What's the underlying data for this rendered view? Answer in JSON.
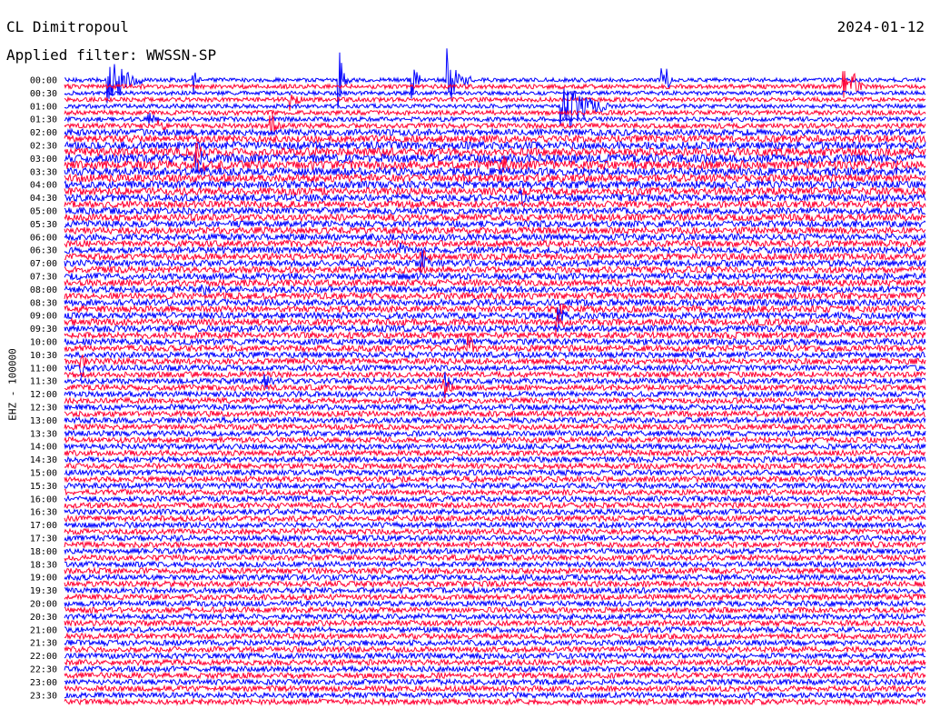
{
  "header": {
    "station": "CL Dimitropoul",
    "filter_prefix": "Applied filter: ",
    "filter_name": "WWSSN-SP",
    "date": "2024-01-12"
  },
  "chart_data": {
    "type": "helicorder",
    "title": "CL Dimitropoul",
    "subtitle": "Applied filter: WWSSN-SP",
    "date": "2024-01-12",
    "ylabel": "EHZ - 100000",
    "row_interval_minutes": 15,
    "colors": {
      "trace_a": "#0000ff",
      "trace_b": "#ff0033",
      "background": "#ffffff"
    },
    "time_labels": [
      "00:00",
      "00:30",
      "01:00",
      "01:30",
      "02:00",
      "02:30",
      "03:00",
      "03:30",
      "04:00",
      "04:30",
      "05:00",
      "05:30",
      "06:00",
      "06:30",
      "07:00",
      "07:30",
      "08:00",
      "08:30",
      "09:00",
      "09:30",
      "10:00",
      "10:30",
      "11:00",
      "11:30",
      "12:00",
      "12:30",
      "13:00",
      "13:30",
      "14:00",
      "14:30",
      "15:00",
      "15:30",
      "16:00",
      "16:30",
      "17:00",
      "17:30",
      "18:00",
      "18:30",
      "19:00",
      "19:30",
      "20:00",
      "20:30",
      "21:00",
      "21:30",
      "22:00",
      "22:30",
      "23:00",
      "23:30"
    ],
    "row_noise_levels": [
      0.15,
      0.22,
      0.15,
      0.22,
      0.2,
      0.25,
      0.25,
      0.32,
      0.55,
      0.65,
      0.75,
      0.8,
      0.9,
      0.9,
      0.8,
      0.75,
      0.7,
      0.7,
      0.65,
      0.6,
      0.6,
      0.6,
      0.55,
      0.55,
      0.55,
      0.55,
      0.55,
      0.55,
      0.55,
      0.55,
      0.55,
      0.55,
      0.55,
      0.55,
      0.55,
      0.55,
      0.55,
      0.55,
      0.55,
      0.5,
      0.5,
      0.5,
      0.45,
      0.45,
      0.4,
      0.4,
      0.4,
      0.4,
      0.4,
      0.4,
      0.4,
      0.4,
      0.4,
      0.4,
      0.4,
      0.4,
      0.4,
      0.4,
      0.4,
      0.4,
      0.4,
      0.4,
      0.4,
      0.4,
      0.4,
      0.4,
      0.4,
      0.4,
      0.4,
      0.4,
      0.4,
      0.4,
      0.4,
      0.4,
      0.4,
      0.4,
      0.4,
      0.4,
      0.4,
      0.4,
      0.4,
      0.4,
      0.4,
      0.4,
      0.4,
      0.4,
      0.4,
      0.4,
      0.4,
      0.4,
      0.4,
      0.4,
      0.4,
      0.4,
      0.4,
      0.4
    ],
    "events": [
      {
        "row": 0,
        "minute": 4.6,
        "amplitude": 12,
        "duration_min": 3.5
      },
      {
        "row": 0,
        "minute": 13.5,
        "amplitude": 4,
        "duration_min": 0.8
      },
      {
        "row": 0,
        "minute": 28.7,
        "amplitude": 10,
        "duration_min": 1.2
      },
      {
        "row": 0,
        "minute": 36.3,
        "amplitude": 6,
        "duration_min": 1.2
      },
      {
        "row": 0,
        "minute": 40,
        "amplitude": 9,
        "duration_min": 2.5
      },
      {
        "row": 0,
        "minute": 62.5,
        "amplitude": 8,
        "duration_min": 1.2
      },
      {
        "row": 1,
        "minute": 81.5,
        "amplitude": 5,
        "duration_min": 1.5
      },
      {
        "row": 1,
        "minute": 82.5,
        "amplitude": 4,
        "duration_min": 1.5
      },
      {
        "row": 3,
        "minute": 23.5,
        "amplitude": 3,
        "duration_min": 1.5
      },
      {
        "row": 4,
        "minute": 52,
        "amplitude": 10,
        "duration_min": 5
      },
      {
        "row": 6,
        "minute": 8.8,
        "amplitude": 3,
        "duration_min": 1
      },
      {
        "row": 7,
        "minute": 9.8,
        "amplitude": 2.5,
        "duration_min": 1
      },
      {
        "row": 7,
        "minute": 21.6,
        "amplitude": 4,
        "duration_min": 1
      },
      {
        "row": 11,
        "minute": 13.8,
        "amplitude": 3,
        "duration_min": 0.8
      },
      {
        "row": 12,
        "minute": 13.8,
        "amplitude": 3.5,
        "duration_min": 1.2
      },
      {
        "row": 13,
        "minute": 13.8,
        "amplitude": 4,
        "duration_min": 1.2
      },
      {
        "row": 13,
        "minute": 45.8,
        "amplitude": 4,
        "duration_min": 1.2
      },
      {
        "row": 18,
        "minute": 47.6,
        "amplitude": 3,
        "duration_min": 1
      },
      {
        "row": 26,
        "minute": 35.3,
        "amplitude": 2.5,
        "duration_min": 1
      },
      {
        "row": 27,
        "minute": 37.4,
        "amplitude": 2.5,
        "duration_min": 1
      },
      {
        "row": 28,
        "minute": 37.4,
        "amplitude": 3,
        "duration_min": 1
      },
      {
        "row": 32,
        "minute": 14.5,
        "amplitude": 2.5,
        "duration_min": 0.8
      },
      {
        "row": 35,
        "minute": 51.5,
        "amplitude": 3,
        "duration_min": 1.2
      },
      {
        "row": 36,
        "minute": 51.5,
        "amplitude": 3.5,
        "duration_min": 1.5
      },
      {
        "row": 37,
        "minute": 51.5,
        "amplitude": 3.5,
        "duration_min": 1.5
      },
      {
        "row": 41,
        "minute": 42.3,
        "amplitude": 4,
        "duration_min": 1
      },
      {
        "row": 43,
        "minute": 1.7,
        "amplitude": 3.5,
        "duration_min": 1
      },
      {
        "row": 44,
        "minute": 1.7,
        "amplitude": 3,
        "duration_min": 1
      },
      {
        "row": 46,
        "minute": 21,
        "amplitude": 3,
        "duration_min": 1
      },
      {
        "row": 46,
        "minute": 39.7,
        "amplitude": 3,
        "duration_min": 1
      },
      {
        "row": 47,
        "minute": 39.7,
        "amplitude": 3,
        "duration_min": 1
      }
    ]
  }
}
